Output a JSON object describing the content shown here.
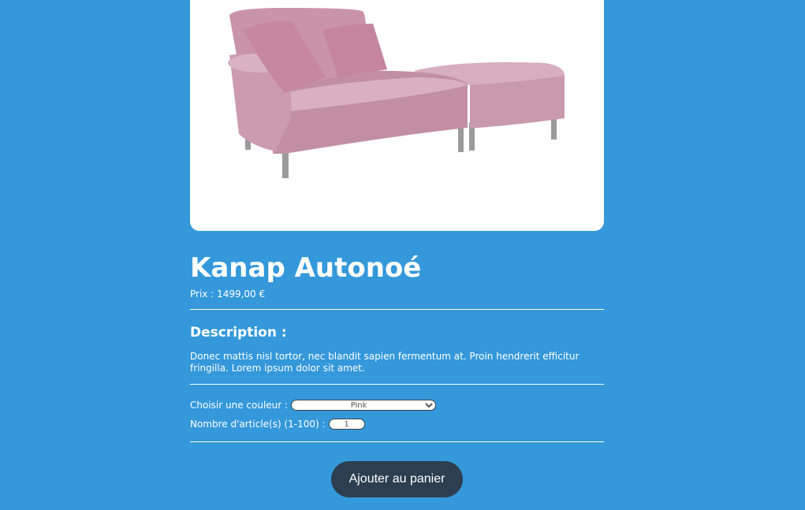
{
  "product": {
    "name": "Kanap Autonoé",
    "price_label": "Prix : 1499,00 €",
    "image_icon": "sofa-image",
    "image_color": "#c99aab"
  },
  "description": {
    "heading": "Description :",
    "text": "Donec mattis nisl tortor, nec blandit sapien fermentum at. Proin hendrerit efficitur fringilla. Lorem ipsum dolor sit amet."
  },
  "options": {
    "color_label": "Choisir une couleur :",
    "color_selected": "Pink",
    "quantity_label": "Nombre d'article(s) (1-100) :",
    "quantity_value": "1"
  },
  "actions": {
    "add_to_cart_label": "Ajouter au panier"
  },
  "colors": {
    "background": "#3498db",
    "button": "#2c3e50",
    "card": "#ffffff"
  }
}
